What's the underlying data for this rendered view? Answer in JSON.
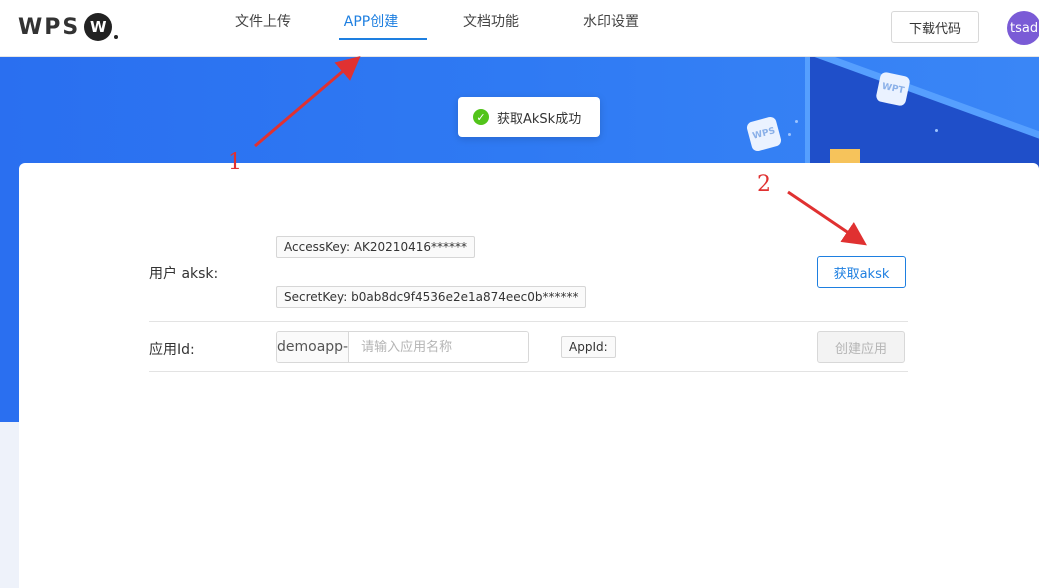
{
  "header": {
    "logo_text": "WPS",
    "logo_badge": "W",
    "nav": [
      {
        "label": "文件上传",
        "active": false
      },
      {
        "label": "APP创建",
        "active": true
      },
      {
        "label": "文档功能",
        "active": false
      },
      {
        "label": "水印设置",
        "active": false
      }
    ],
    "download_label": "下载代码",
    "avatar_text": "tsadm"
  },
  "banner": {
    "bubble_1": "WPS",
    "bubble_2": "WPT"
  },
  "toast": {
    "message": "获取AkSk成功",
    "icon": "check-circle-icon",
    "color": "#52c41a"
  },
  "form": {
    "aksk_label": "用户 aksk:",
    "access_key": "AccessKey: AK20210416******",
    "secret_key": "SecretKey: b0ab8dc9f4536e2e1a874eec0b******",
    "get_aksk_label": "获取aksk",
    "appid_label": "应用Id:",
    "app_prefix": "demoapp-",
    "app_placeholder": "请输入应用名称",
    "appid_tag": "AppId:",
    "create_label": "创建应用"
  },
  "annotations": {
    "label_1": "1",
    "label_2": "2",
    "color": "#e03131"
  },
  "colors": {
    "accent": "#1e7fe0",
    "banner": "#2f7af3"
  }
}
